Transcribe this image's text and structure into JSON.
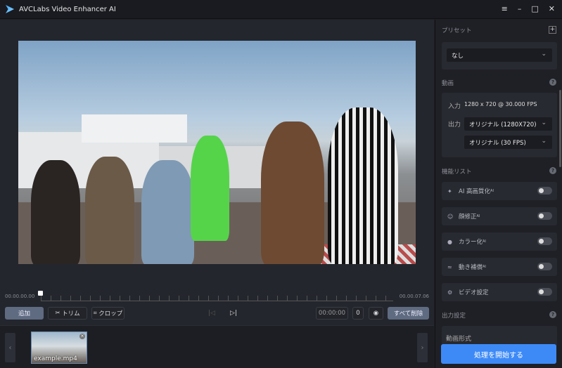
{
  "app": {
    "title": "AVCLabs Video Enhancer AI",
    "window_buttons": [
      "≡",
      "–",
      "□",
      "✕"
    ]
  },
  "timeline": {
    "start": "00.00.00.00",
    "end": "00.00.07.06"
  },
  "controls": {
    "add": "追加",
    "trim": "トリム",
    "crop": "クロップ",
    "time": "00:00:00",
    "frame": "0",
    "clear_all": "すべて削除"
  },
  "filmstrip": {
    "items": [
      {
        "name": "example.mp4"
      }
    ]
  },
  "sidebar": {
    "preset": {
      "label": "プリセット",
      "value": "なし"
    },
    "video": {
      "label": "動画",
      "input_label": "入力",
      "input_value": "1280 x 720 @ 30.000 FPS",
      "output_label": "出力",
      "resolution": "オリジナル (1280X720)",
      "fps": "オリジナル (30 FPS)"
    },
    "features": {
      "label": "機能リスト",
      "items": [
        {
          "label": "AI 高画質化",
          "ai": "AI",
          "icon": "sparkle-icon",
          "on": false
        },
        {
          "label": "顔修正",
          "ai": "AI",
          "icon": "face-icon",
          "on": false
        },
        {
          "label": "カラー化",
          "ai": "AI",
          "icon": "palette-icon",
          "on": false
        },
        {
          "label": "動き補償",
          "ai": "AI",
          "icon": "motion-icon",
          "on": false
        },
        {
          "label": "ビデオ設定",
          "ai": "",
          "icon": "gear-icon",
          "on": false
        }
      ]
    },
    "output": {
      "label": "出力設定",
      "format_label": "動画形式"
    },
    "start": "処理を開始する"
  },
  "colors": {
    "accent": "#3d8af7"
  }
}
